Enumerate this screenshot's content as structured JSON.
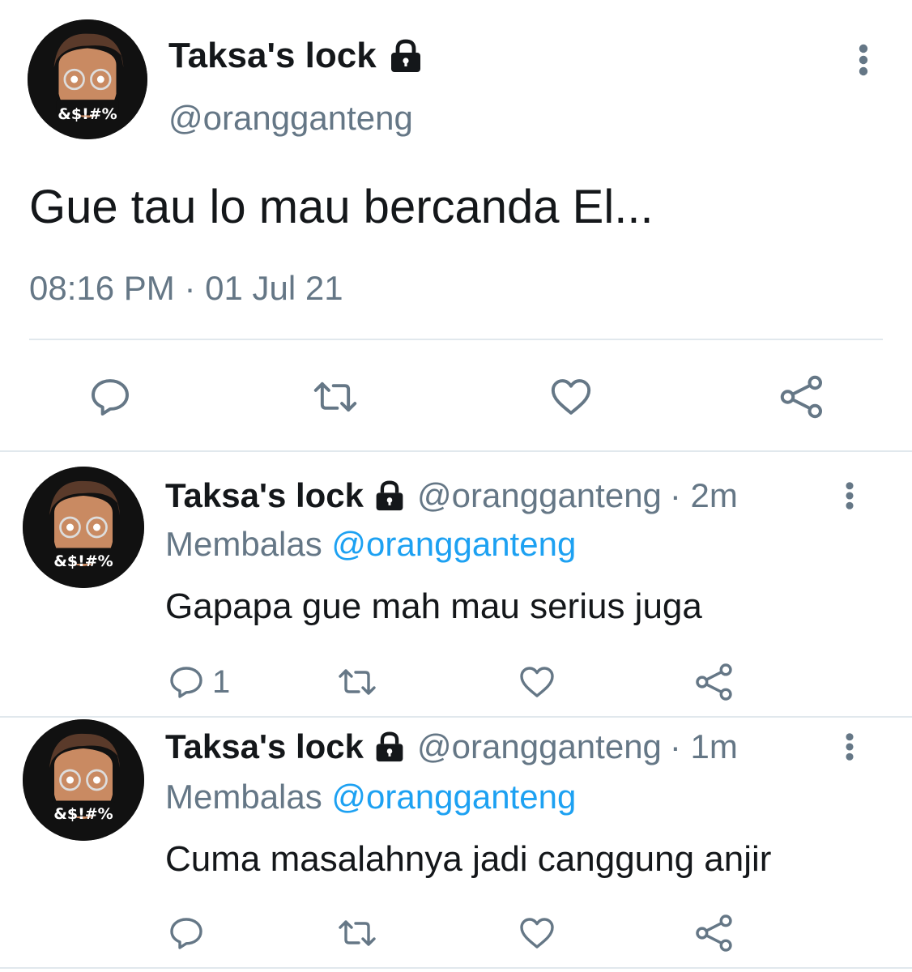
{
  "main_tweet": {
    "display_name": "Taksa's lock",
    "handle": "@orangganteng",
    "text": "Gue tau lo mau bercanda El...",
    "timestamp": "08:16 PM · 01 Jul 21",
    "avatar_caption": "&$!#%"
  },
  "replies": [
    {
      "display_name": "Taksa's lock",
      "handle": "@orangganteng",
      "time": "· 2m",
      "replying_label": "Membalas",
      "replying_to": "@orangganteng",
      "text": "Gapapa gue mah mau serius juga",
      "reply_count": "1",
      "avatar_caption": "&$!#%"
    },
    {
      "display_name": "Taksa's lock",
      "handle": "@orangganteng",
      "time": "· 1m",
      "replying_label": "Membalas",
      "replying_to": "@orangganteng",
      "text": "Cuma masalahnya jadi canggung anjir",
      "reply_count": "",
      "avatar_caption": "&$!#%"
    }
  ],
  "colors": {
    "text": "#14171a",
    "secondary": "#657786",
    "accent": "#1da1f2",
    "divider": "#e1e8ed"
  },
  "icons": [
    "lock-icon",
    "more-options-icon",
    "reply-icon",
    "retweet-icon",
    "like-icon",
    "share-icon"
  ]
}
